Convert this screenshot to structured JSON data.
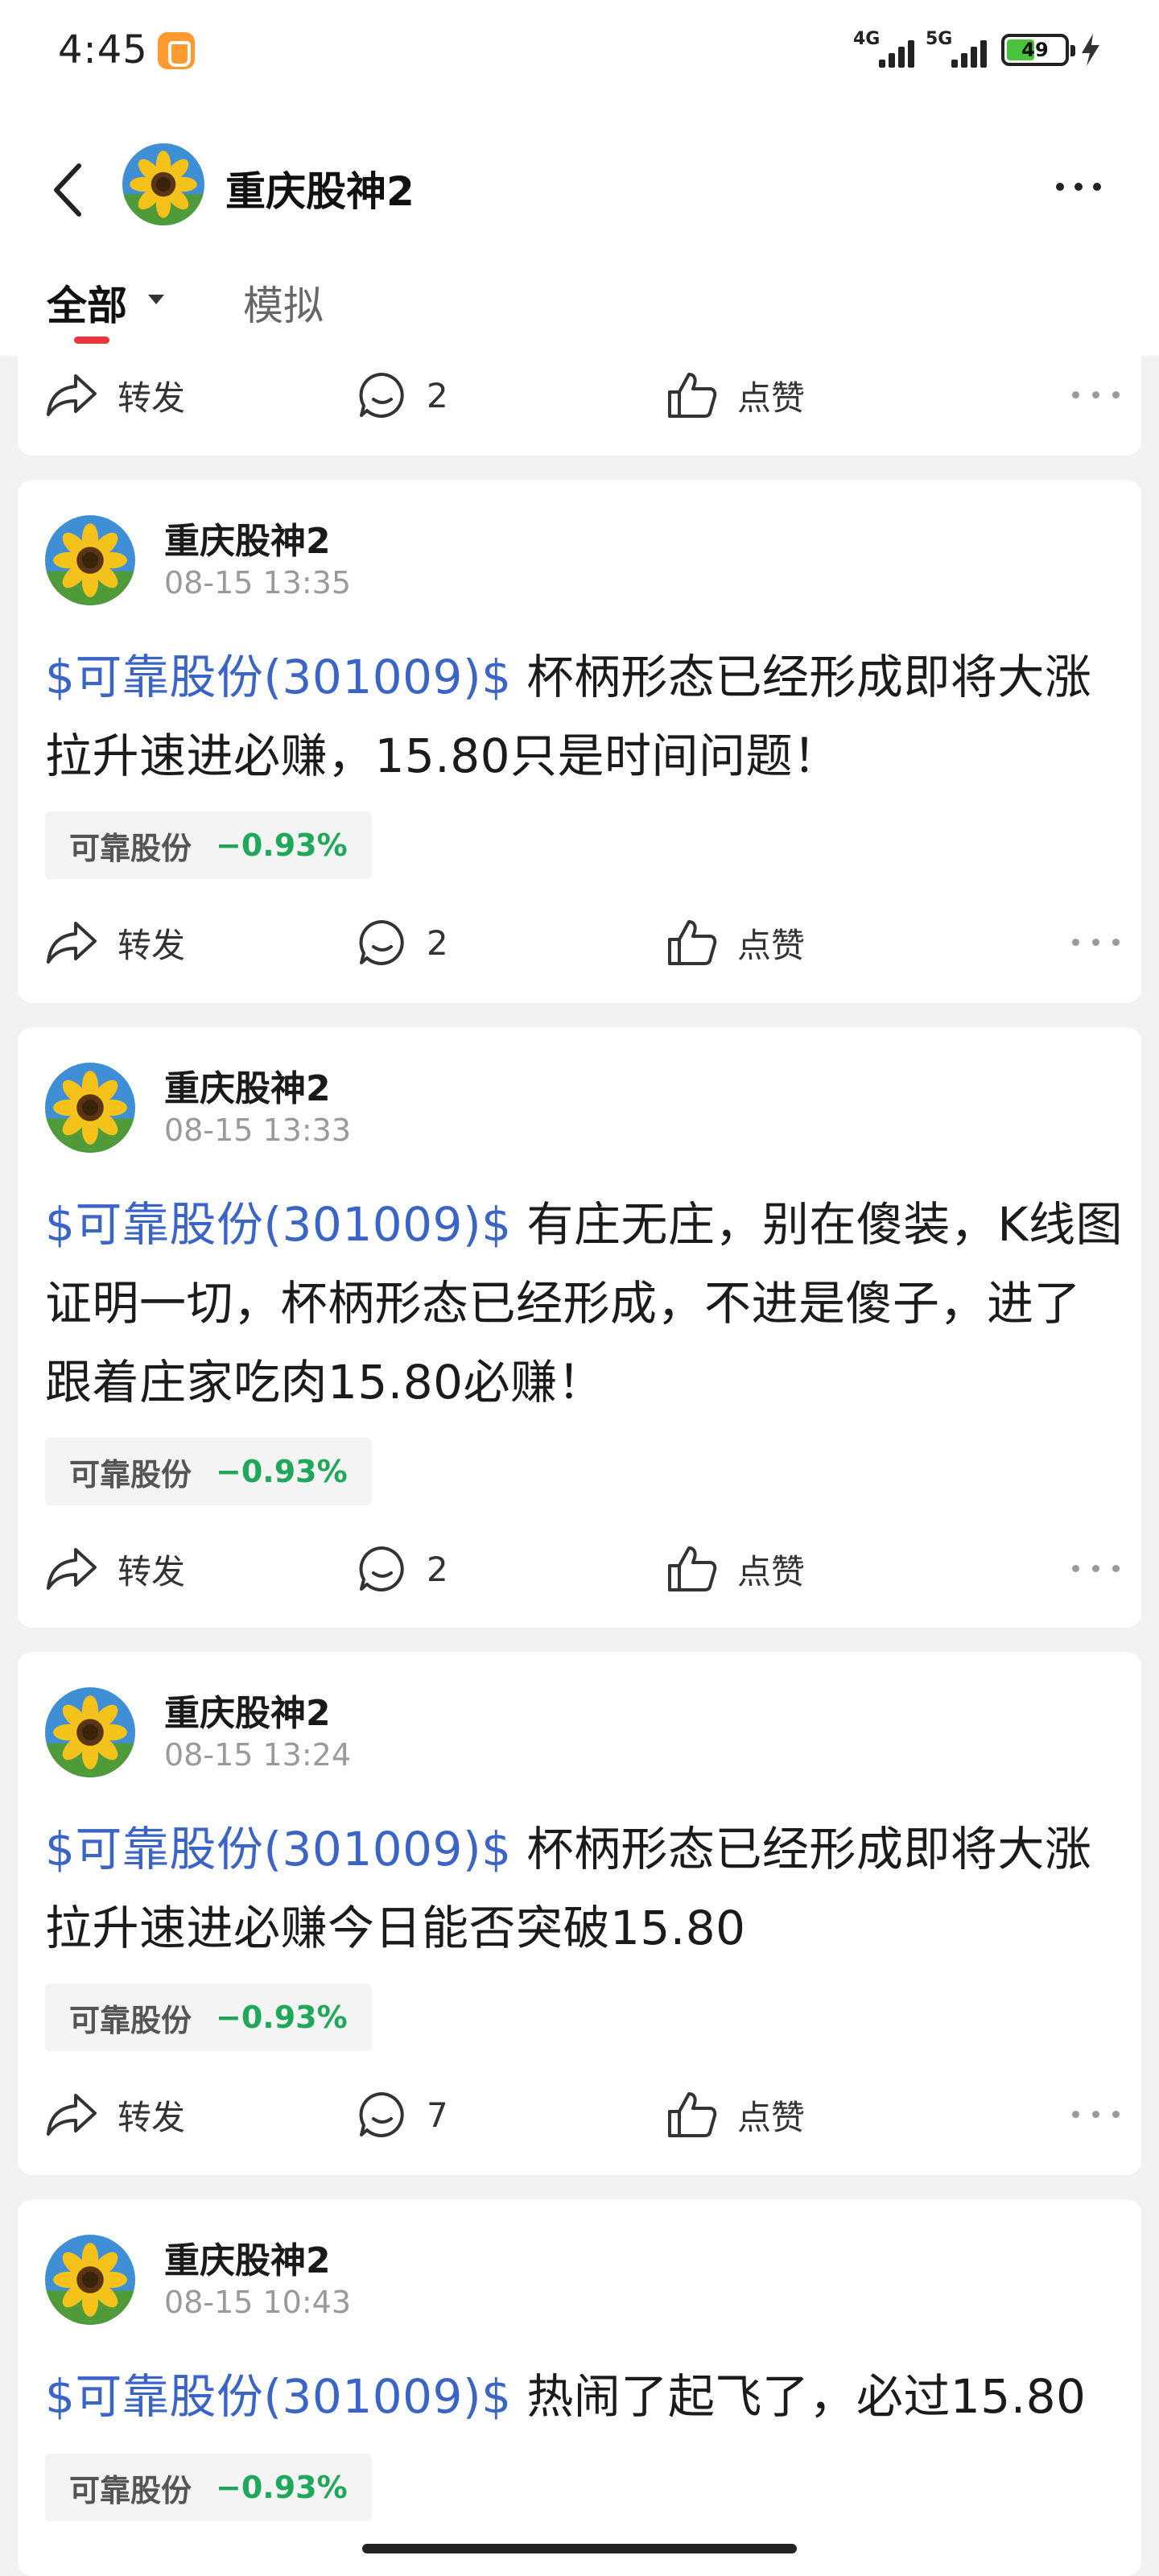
{
  "status_bar": {
    "time": "4:45",
    "signal_1_label": "4G",
    "signal_2_label": "5G",
    "battery_level": "49",
    "battery_fraction": 0.49
  },
  "header": {
    "title": "重庆股神2",
    "back_icon": "chevron-left-icon",
    "more_icon": "more-horizontal-icon"
  },
  "tabs": {
    "all_label": "全部",
    "sim_label": "模拟"
  },
  "colors": {
    "link": "#3a64c6",
    "down_green": "#1fa75a",
    "tab_underline": "#e8363c",
    "battery_fill": "#4bc23c"
  },
  "actions": {
    "forward_label": "转发",
    "like_label": "点赞"
  },
  "partial_card": {
    "comment_count": "2"
  },
  "posts": [
    {
      "author": "重庆股神2",
      "time": "08-15 13:35",
      "stock_link": "$可靠股份(301009)$",
      "text": " 杯柄形态已经形成即将大涨拉升速进必赚，15.80只是时间问题！",
      "tag_name": "可靠股份",
      "tag_change": "−0.93%",
      "comment_count": "2"
    },
    {
      "author": "重庆股神2",
      "time": "08-15 13:33",
      "stock_link": "$可靠股份(301009)$",
      "text": " 有庄无庄，别在傻装，K线图证明一切，杯柄形态已经形成，不进是傻子，进了跟着庄家吃肉15.80必赚！",
      "tag_name": "可靠股份",
      "tag_change": "−0.93%",
      "comment_count": "2"
    },
    {
      "author": "重庆股神2",
      "time": "08-15 13:24",
      "stock_link": "$可靠股份(301009)$",
      "text": " 杯柄形态已经形成即将大涨拉升速进必赚今日能否突破15.80",
      "tag_name": "可靠股份",
      "tag_change": "−0.93%",
      "comment_count": "7"
    },
    {
      "author": "重庆股神2",
      "time": "08-15 10:43",
      "stock_link": "$可靠股份(301009)$",
      "text": " 热闹了起飞了，必过15.80",
      "tag_name": "可靠股份",
      "tag_change": "−0.93%"
    }
  ]
}
